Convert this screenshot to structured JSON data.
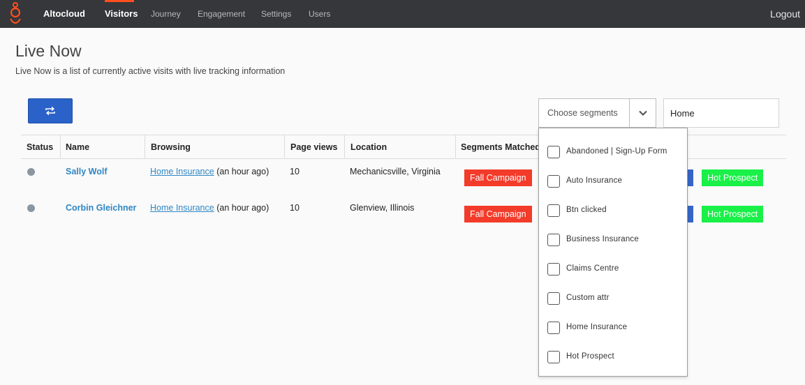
{
  "colors": {
    "navbar_bg": "#35373a",
    "accent_orange": "#ff4f1f",
    "primary_blue": "#2a62c9",
    "link_blue": "#2f86c4",
    "badge_red": "#f33b2a",
    "badge_green": "#19f048",
    "status_gray": "#8a96a1"
  },
  "navbar": {
    "logo_icon": "genesys-logo-icon",
    "brand": "Altocloud",
    "items": [
      {
        "label": "Visitors",
        "active": true
      },
      {
        "label": "Journey",
        "active": false
      },
      {
        "label": "Engagement",
        "active": false
      },
      {
        "label": "Settings",
        "active": false
      },
      {
        "label": "Users",
        "active": false
      }
    ],
    "logout": "Logout"
  },
  "header": {
    "title": "Live Now",
    "description": "Live Now is a list of currently active visits with live tracking information"
  },
  "toolbar": {
    "refresh_icon": "refresh-icon",
    "segments_placeholder": "Choose segments",
    "chevron_icon": "chevron-down-icon",
    "search_value": "Home"
  },
  "table": {
    "columns": [
      "Status",
      "Name",
      "Browsing",
      "Page views",
      "Location",
      "Segments Matched"
    ],
    "rows": [
      {
        "status": "active",
        "name": "Sally Wolf",
        "page": "Home Insurance",
        "time": "(an hour ago)",
        "page_views": "10",
        "location": "Mechanicsville, Virginia",
        "segments": [
          "Fall Campaign",
          "Hot Prospect"
        ]
      },
      {
        "status": "active",
        "name": "Corbin Gleichner",
        "page": "Home Insurance",
        "time": "(an hour ago)",
        "page_views": "10",
        "location": "Glenview, Illinois",
        "segments": [
          "Fall Campaign",
          "Hot Prospect"
        ]
      }
    ]
  },
  "segments_dropdown": {
    "options": [
      {
        "label": "Abandoned | Sign-Up Form",
        "checked": false
      },
      {
        "label": "Auto Insurance",
        "checked": false
      },
      {
        "label": "Btn clicked",
        "checked": false
      },
      {
        "label": "Business Insurance",
        "checked": false
      },
      {
        "label": "Claims Centre",
        "checked": false
      },
      {
        "label": "Custom attr",
        "checked": false
      },
      {
        "label": "Home Insurance",
        "checked": false
      },
      {
        "label": "Hot Prospect",
        "checked": false
      }
    ]
  }
}
